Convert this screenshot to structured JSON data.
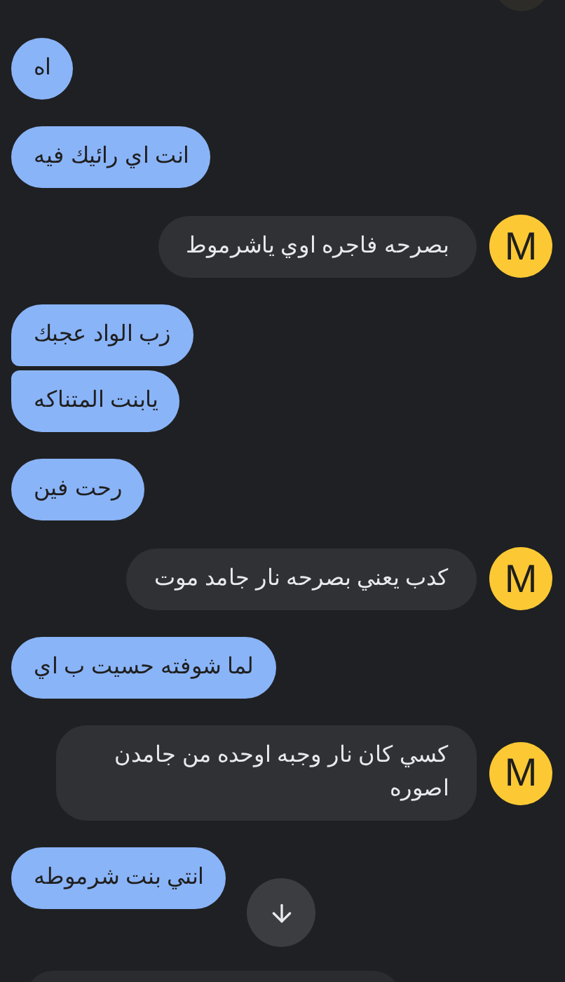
{
  "messages": [
    {
      "kind": "outgoing",
      "text": "اه",
      "joined_above": false,
      "joined_below": false
    },
    {
      "kind": "outgoing",
      "text": "انت اي رائيك فيه",
      "joined_above": false,
      "joined_below": false
    },
    {
      "kind": "incoming",
      "text": "بصرحه فاجره اوي  ياشرموط",
      "avatar": "M"
    },
    {
      "kind": "outgoing",
      "text": "زب الواد عجبك",
      "joined_above": false,
      "joined_below": true
    },
    {
      "kind": "outgoing",
      "text": "يابنت المتناكه",
      "joined_above": true,
      "joined_below": false
    },
    {
      "kind": "outgoing",
      "text": "رحت فين",
      "joined_above": false,
      "joined_below": false
    },
    {
      "kind": "incoming",
      "text": "كدب يعني بصرحه نار جامد  موت",
      "avatar": "M"
    },
    {
      "kind": "outgoing",
      "text": "لما شوفته حسيت ب اي",
      "joined_above": false,
      "joined_below": false
    },
    {
      "kind": "incoming",
      "text": "كسي كان نار وجبه اوحده من جامدن اصوره",
      "avatar": "M"
    },
    {
      "kind": "outgoing",
      "text": "انتي بنت شرموطه",
      "joined_above": false,
      "joined_below": false
    }
  ]
}
